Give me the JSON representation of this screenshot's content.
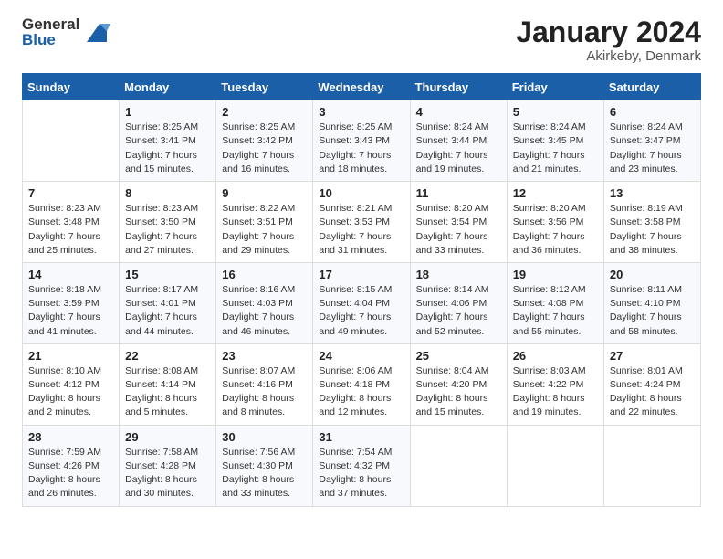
{
  "header": {
    "logo_general": "General",
    "logo_blue": "Blue",
    "title": "January 2024",
    "subtitle": "Akirkeby, Denmark"
  },
  "calendar": {
    "weekdays": [
      "Sunday",
      "Monday",
      "Tuesday",
      "Wednesday",
      "Thursday",
      "Friday",
      "Saturday"
    ],
    "weeks": [
      [
        {
          "day": "",
          "info": ""
        },
        {
          "day": "1",
          "info": "Sunrise: 8:25 AM\nSunset: 3:41 PM\nDaylight: 7 hours\nand 15 minutes."
        },
        {
          "day": "2",
          "info": "Sunrise: 8:25 AM\nSunset: 3:42 PM\nDaylight: 7 hours\nand 16 minutes."
        },
        {
          "day": "3",
          "info": "Sunrise: 8:25 AM\nSunset: 3:43 PM\nDaylight: 7 hours\nand 18 minutes."
        },
        {
          "day": "4",
          "info": "Sunrise: 8:24 AM\nSunset: 3:44 PM\nDaylight: 7 hours\nand 19 minutes."
        },
        {
          "day": "5",
          "info": "Sunrise: 8:24 AM\nSunset: 3:45 PM\nDaylight: 7 hours\nand 21 minutes."
        },
        {
          "day": "6",
          "info": "Sunrise: 8:24 AM\nSunset: 3:47 PM\nDaylight: 7 hours\nand 23 minutes."
        }
      ],
      [
        {
          "day": "7",
          "info": "Sunrise: 8:23 AM\nSunset: 3:48 PM\nDaylight: 7 hours\nand 25 minutes."
        },
        {
          "day": "8",
          "info": "Sunrise: 8:23 AM\nSunset: 3:50 PM\nDaylight: 7 hours\nand 27 minutes."
        },
        {
          "day": "9",
          "info": "Sunrise: 8:22 AM\nSunset: 3:51 PM\nDaylight: 7 hours\nand 29 minutes."
        },
        {
          "day": "10",
          "info": "Sunrise: 8:21 AM\nSunset: 3:53 PM\nDaylight: 7 hours\nand 31 minutes."
        },
        {
          "day": "11",
          "info": "Sunrise: 8:20 AM\nSunset: 3:54 PM\nDaylight: 7 hours\nand 33 minutes."
        },
        {
          "day": "12",
          "info": "Sunrise: 8:20 AM\nSunset: 3:56 PM\nDaylight: 7 hours\nand 36 minutes."
        },
        {
          "day": "13",
          "info": "Sunrise: 8:19 AM\nSunset: 3:58 PM\nDaylight: 7 hours\nand 38 minutes."
        }
      ],
      [
        {
          "day": "14",
          "info": "Sunrise: 8:18 AM\nSunset: 3:59 PM\nDaylight: 7 hours\nand 41 minutes."
        },
        {
          "day": "15",
          "info": "Sunrise: 8:17 AM\nSunset: 4:01 PM\nDaylight: 7 hours\nand 44 minutes."
        },
        {
          "day": "16",
          "info": "Sunrise: 8:16 AM\nSunset: 4:03 PM\nDaylight: 7 hours\nand 46 minutes."
        },
        {
          "day": "17",
          "info": "Sunrise: 8:15 AM\nSunset: 4:04 PM\nDaylight: 7 hours\nand 49 minutes."
        },
        {
          "day": "18",
          "info": "Sunrise: 8:14 AM\nSunset: 4:06 PM\nDaylight: 7 hours\nand 52 minutes."
        },
        {
          "day": "19",
          "info": "Sunrise: 8:12 AM\nSunset: 4:08 PM\nDaylight: 7 hours\nand 55 minutes."
        },
        {
          "day": "20",
          "info": "Sunrise: 8:11 AM\nSunset: 4:10 PM\nDaylight: 7 hours\nand 58 minutes."
        }
      ],
      [
        {
          "day": "21",
          "info": "Sunrise: 8:10 AM\nSunset: 4:12 PM\nDaylight: 8 hours\nand 2 minutes."
        },
        {
          "day": "22",
          "info": "Sunrise: 8:08 AM\nSunset: 4:14 PM\nDaylight: 8 hours\nand 5 minutes."
        },
        {
          "day": "23",
          "info": "Sunrise: 8:07 AM\nSunset: 4:16 PM\nDaylight: 8 hours\nand 8 minutes."
        },
        {
          "day": "24",
          "info": "Sunrise: 8:06 AM\nSunset: 4:18 PM\nDaylight: 8 hours\nand 12 minutes."
        },
        {
          "day": "25",
          "info": "Sunrise: 8:04 AM\nSunset: 4:20 PM\nDaylight: 8 hours\nand 15 minutes."
        },
        {
          "day": "26",
          "info": "Sunrise: 8:03 AM\nSunset: 4:22 PM\nDaylight: 8 hours\nand 19 minutes."
        },
        {
          "day": "27",
          "info": "Sunrise: 8:01 AM\nSunset: 4:24 PM\nDaylight: 8 hours\nand 22 minutes."
        }
      ],
      [
        {
          "day": "28",
          "info": "Sunrise: 7:59 AM\nSunset: 4:26 PM\nDaylight: 8 hours\nand 26 minutes."
        },
        {
          "day": "29",
          "info": "Sunrise: 7:58 AM\nSunset: 4:28 PM\nDaylight: 8 hours\nand 30 minutes."
        },
        {
          "day": "30",
          "info": "Sunrise: 7:56 AM\nSunset: 4:30 PM\nDaylight: 8 hours\nand 33 minutes."
        },
        {
          "day": "31",
          "info": "Sunrise: 7:54 AM\nSunset: 4:32 PM\nDaylight: 8 hours\nand 37 minutes."
        },
        {
          "day": "",
          "info": ""
        },
        {
          "day": "",
          "info": ""
        },
        {
          "day": "",
          "info": ""
        }
      ]
    ]
  }
}
